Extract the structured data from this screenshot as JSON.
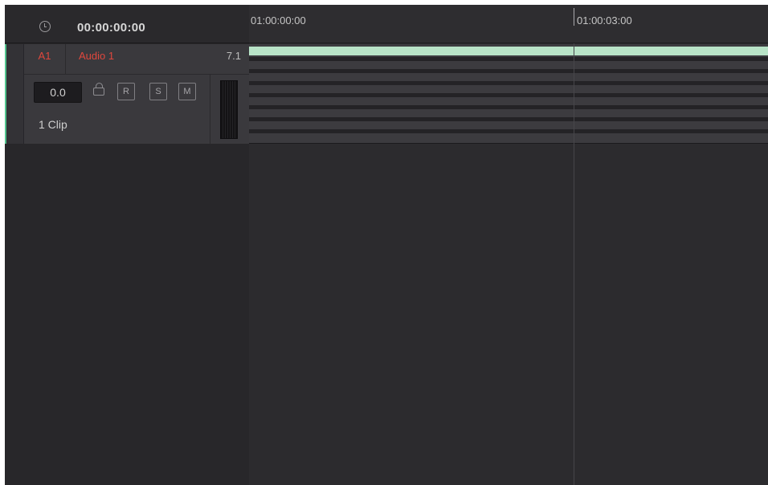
{
  "header": {
    "timecode": "00:00:00:00",
    "clock_icon": "clock-icon"
  },
  "track": {
    "id": "A1",
    "name": "Audio 1",
    "format": "7.1",
    "volume": "0.0",
    "clip_count": "1 Clip",
    "buttons": {
      "record": "R",
      "solo": "S",
      "mute": "M"
    },
    "lock_icon": "lock-icon",
    "id_color": "#e0473d",
    "accent_color": "#52c48e"
  },
  "timeline": {
    "ruler_labels": [
      "01:00:00:00",
      "01:00:03:00"
    ],
    "clip_color": "#b8e3c7",
    "audio_channels": 8
  }
}
